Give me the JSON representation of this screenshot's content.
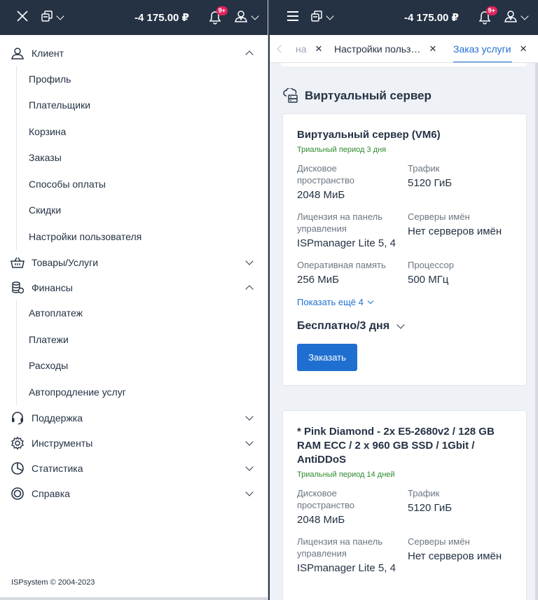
{
  "header": {
    "balance": "-4 175.00 ₽",
    "notifications_badge": "9+"
  },
  "sidebar": {
    "groups": [
      {
        "label": "Клиент",
        "icon": "user-icon",
        "expanded": true,
        "items": [
          "Профиль",
          "Плательщики",
          "Корзина",
          "Заказы",
          "Способы оплаты",
          "Скидки",
          "Настройки пользователя"
        ]
      },
      {
        "label": "Товары/Услуги",
        "icon": "basket-icon",
        "expanded": false
      },
      {
        "label": "Финансы",
        "icon": "coins-icon",
        "expanded": true,
        "items": [
          "Автоплатеж",
          "Платежи",
          "Расходы",
          "Автопродление услуг"
        ]
      },
      {
        "label": "Поддержка",
        "icon": "headset-icon",
        "expanded": false
      },
      {
        "label": "Инструменты",
        "icon": "gear-icon",
        "expanded": false
      },
      {
        "label": "Статистика",
        "icon": "pie-chart-icon",
        "expanded": false
      },
      {
        "label": "Справка",
        "icon": "lifebuoy-icon",
        "expanded": false
      }
    ],
    "footer": "ISPsystem © 2004-2023"
  },
  "tabs": [
    {
      "label": "на",
      "state": "faded"
    },
    {
      "label": "Настройки польз…",
      "state": "normal"
    },
    {
      "label": "Заказ услуги",
      "state": "active"
    }
  ],
  "section": {
    "title": "Виртуальный сервер"
  },
  "cards": [
    {
      "title": "Виртуальный сервер (VM6)",
      "trial": "Триальный период 3 дня",
      "specs": [
        {
          "label": "Дисковое пространство",
          "value": "2048 МиБ"
        },
        {
          "label": "Трафик",
          "value": "5120 ГиБ"
        },
        {
          "label": "Лицензия на панель управления",
          "value": "ISPmanager Lite 5, 4"
        },
        {
          "label": "Серверы имён",
          "value": "Нет серверов имён"
        },
        {
          "label": "Оперативная память",
          "value": "256 МиБ"
        },
        {
          "label": "Процессор",
          "value": "500 МГц"
        }
      ],
      "more": "Показать ещё 4",
      "price": "Бесплатно/3 дня",
      "order": "Заказать"
    },
    {
      "title": "* Pink Diamond - 2x E5-2680v2 / 128 GB RAM ECC / 2 x 960 GB SSD / 1Gbit / AntiDDoS",
      "trial": "Триальный период 14 дней",
      "specs": [
        {
          "label": "Дисковое пространство",
          "value": "2048 МиБ"
        },
        {
          "label": "Трафик",
          "value": "5120 ГиБ"
        },
        {
          "label": "Лицензия на панель управления",
          "value": "ISPmanager Lite 5, 4"
        },
        {
          "label": "Серверы имён",
          "value": "Нет серверов имён"
        }
      ]
    }
  ]
}
